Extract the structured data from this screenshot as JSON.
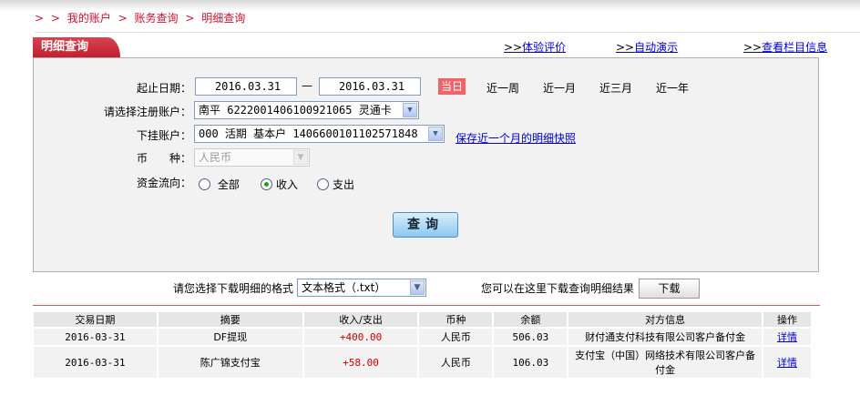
{
  "breadcrumb": {
    "sep": ">",
    "items": [
      "我的账户",
      "账务查询",
      "明细查询"
    ]
  },
  "tab_title": "明细查询",
  "top_links": [
    {
      "prefix": ">>",
      "label": "体验评价"
    },
    {
      "prefix": ">>",
      "label": "自动演示"
    },
    {
      "prefix": ">>",
      "label": "查看栏目信息"
    }
  ],
  "form": {
    "date_label": "起止日期：",
    "date_start": "2016.03.31",
    "date_sep": "—",
    "date_end": "2016.03.31",
    "quick": [
      "当日",
      "近一周",
      "近一月",
      "近三月",
      "近一年"
    ],
    "account_label": "请选择注册账户：",
    "account_value": "南平 6222001406100921065 灵通卡",
    "sub_label": "下挂账户：",
    "sub_value": "000 活期 基本户 1406600101102571848",
    "snapshot_link": "保存近一个月的明细快照",
    "currency_label": "币　　种：",
    "currency_value": "人民币",
    "flow_label": "资金流向：",
    "flow_options": [
      "全部",
      "收入",
      "支出"
    ],
    "flow_selected": "收入",
    "query_button": "查询"
  },
  "download": {
    "format_label": "请您选择下载明细的格式",
    "format_value": "文本格式（.txt）",
    "hint": "您可以在这里下载查询明细结果",
    "button": "下载"
  },
  "table": {
    "headers": [
      "交易日期",
      "摘要",
      "收入/支出",
      "币种",
      "余额",
      "对方信息",
      "操作"
    ],
    "rows": [
      [
        "2016-03-31",
        "DF提现",
        "+400.00",
        "人民币",
        "506.03",
        "财付通支付科技有限公司客户备付金",
        "详情"
      ],
      [
        "2016-03-31",
        "陈广锦支付宝",
        "+58.00",
        "人民币",
        "106.03",
        "支付宝（中国）网络技术有限公司客户备付金",
        "详情"
      ]
    ]
  },
  "colors": {
    "brand": "#c4122f",
    "accent_today": "#f06467",
    "link": "#0000cc",
    "amount": "#cc0000"
  }
}
